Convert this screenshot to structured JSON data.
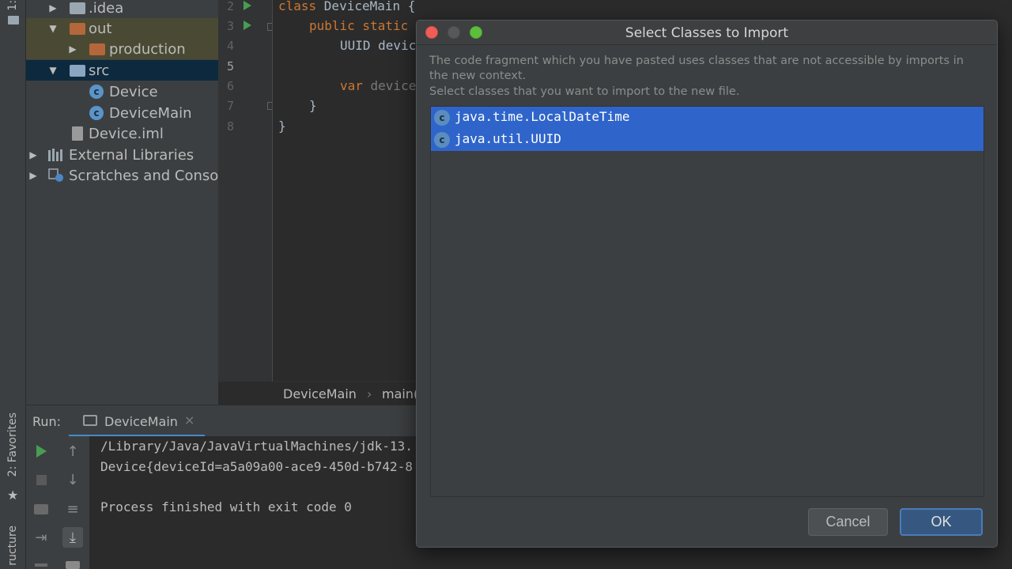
{
  "tool_stripe": {
    "top_label": "1:",
    "favorites_label": "2: Favorites",
    "structure_label": "ructure"
  },
  "project_tree": [
    {
      "label": ".idea",
      "type": "folder-grey",
      "expanded": false
    },
    {
      "label": "out",
      "type": "folder-orange",
      "expanded": true
    },
    {
      "label": "production",
      "type": "folder-orange",
      "expanded": false
    },
    {
      "label": "src",
      "type": "folder-blue",
      "expanded": true
    },
    {
      "label": "Device",
      "type": "class"
    },
    {
      "label": "DeviceMain",
      "type": "class-runnable"
    },
    {
      "label": "Device.iml",
      "type": "file"
    },
    {
      "label": "External Libraries",
      "type": "libraries",
      "expanded": false
    },
    {
      "label": "Scratches and Consol",
      "type": "scratches",
      "expanded": false
    }
  ],
  "editor": {
    "line_numbers": [
      "2",
      "3",
      "4",
      "5",
      "6",
      "7",
      "8"
    ],
    "lines": {
      "l2_kw": "class ",
      "l2_rest": "DeviceMain {",
      "l3_kw": "public static",
      "l4": "UUID devic",
      "l6_kw": "var ",
      "l6_rest": "device",
      "l7": "}",
      "l8": "}"
    },
    "breadcrumb": [
      "DeviceMain",
      "main("
    ]
  },
  "run_panel": {
    "title": "Run:",
    "tab_label": "DeviceMain",
    "tab_close": "×",
    "console_lines": [
      "/Library/Java/JavaVirtualMachines/jdk-13.",
      "Device{deviceId=a5a09a00-ace9-450d-b742-8",
      "",
      "Process finished with exit code 0"
    ]
  },
  "dialog": {
    "title": "Select Classes to Import",
    "description_line1": "The code fragment which you have pasted uses classes that are not accessible by imports in",
    "description_line2": "the new context.",
    "description_line3": "Select classes that you want to import to the new file.",
    "classes": [
      {
        "name": "java.time.LocalDateTime",
        "selected": true
      },
      {
        "name": "java.util.UUID",
        "selected": true
      }
    ],
    "cancel_label": "Cancel",
    "ok_label": "OK",
    "class_icon_letter": "c"
  },
  "colors": {
    "selection": "#2f65ca",
    "keyword": "#cc7832",
    "run_green": "#499c54",
    "close_red": "#ee5e57",
    "maximize_green": "#5ebd3d"
  }
}
